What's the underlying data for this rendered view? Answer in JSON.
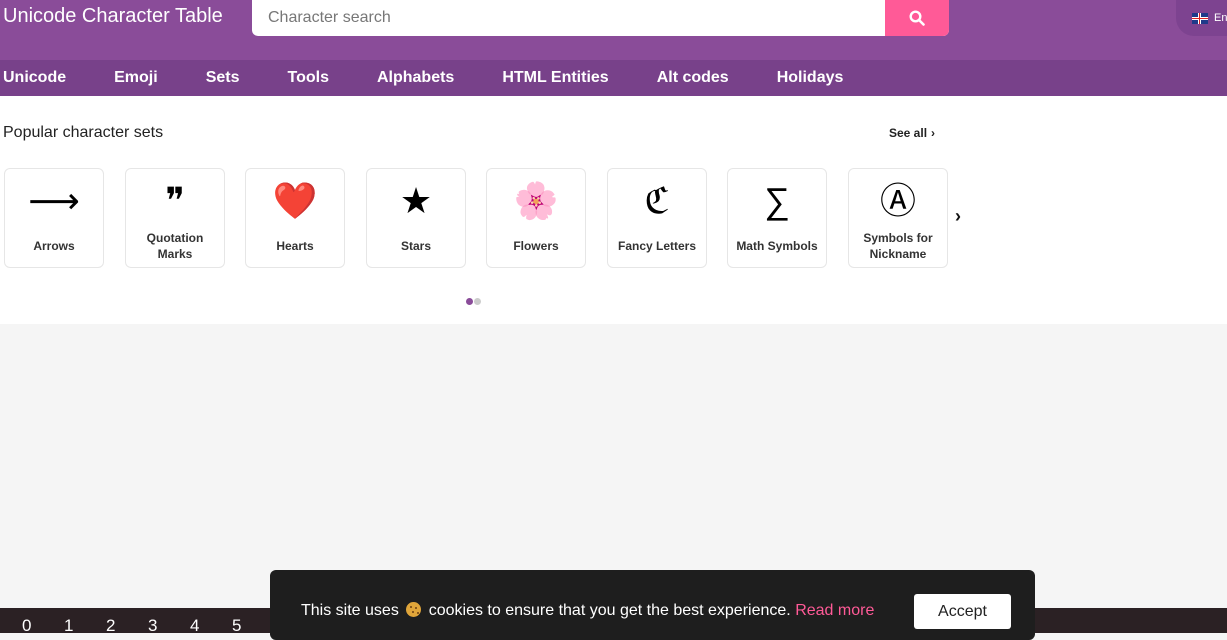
{
  "header": {
    "brand": "Unicode Character Table",
    "search_placeholder": "Character search",
    "language": "En"
  },
  "nav": {
    "items": [
      "Unicode",
      "Emoji",
      "Sets",
      "Tools",
      "Alphabets",
      "HTML Entities",
      "Alt codes",
      "Holidays"
    ]
  },
  "popular": {
    "title": "Popular character sets",
    "see_all": "See all",
    "sets": [
      {
        "symbol": "⟶",
        "label": "Arrows"
      },
      {
        "symbol": "❞",
        "label": "Quotation Marks"
      },
      {
        "symbol": "❤️",
        "label": "Hearts"
      },
      {
        "symbol": "★",
        "label": "Stars"
      },
      {
        "symbol": "🌸",
        "label": "Flowers"
      },
      {
        "symbol": "ℭ",
        "label": "Fancy Letters"
      },
      {
        "symbol": "∑",
        "label": "Math Symbols"
      },
      {
        "symbol": "Ⓐ",
        "label": "Symbols for Nickname"
      }
    ],
    "pager": {
      "pages": 2,
      "active": 1
    },
    "colors": {
      "active_dot": "#8a4c99",
      "inactive_dot": "#cccccc"
    }
  },
  "digits": [
    "0",
    "1",
    "2",
    "3",
    "4",
    "5"
  ],
  "cookie": {
    "text_before": "This site uses",
    "text_after": "cookies to ensure that you get the best experience.",
    "read_more": "Read more",
    "accept": "Accept"
  },
  "colors": {
    "header_bg": "#8a4c99",
    "nav_bg": "#78418a",
    "search_button": "#ff5a97",
    "link_pink": "#ff5a97"
  },
  "icons": {
    "search": "search-icon",
    "next": "chevron-right-icon",
    "flag": "uk-flag-icon"
  }
}
